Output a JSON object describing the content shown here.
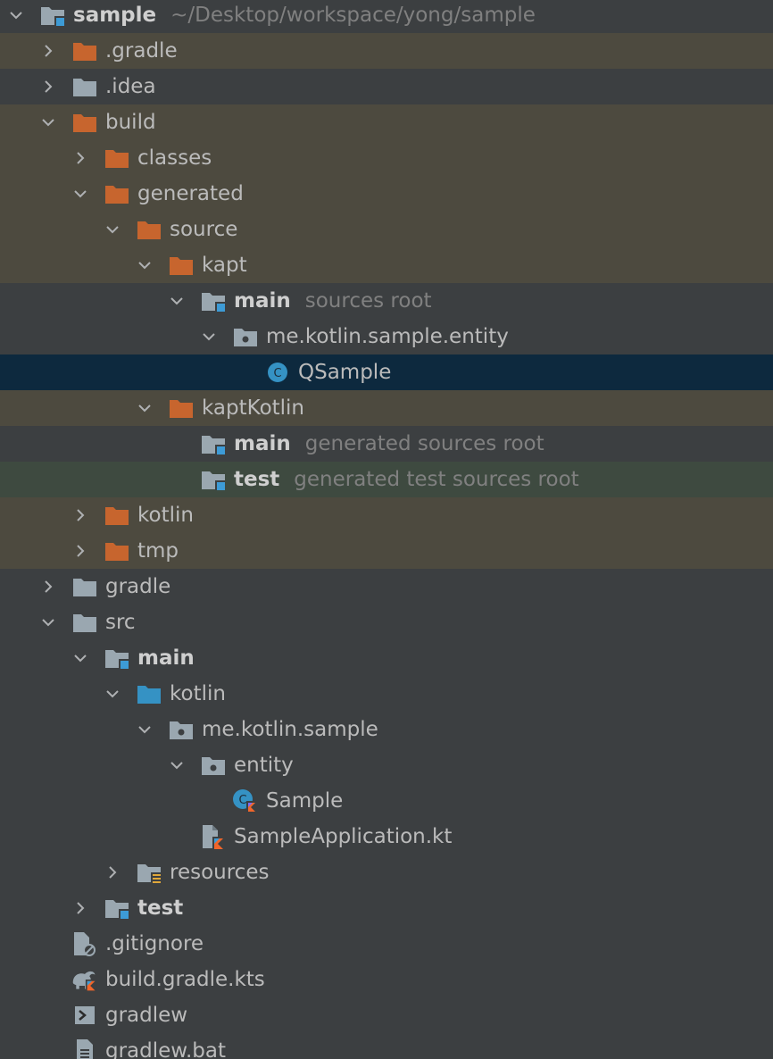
{
  "tree": [
    {
      "name": "sample",
      "hint": "~/Desktop/workspace/yong/sample",
      "bold": true,
      "depth": 0,
      "arrow": "expanded",
      "icon": "module-folder-icon",
      "bg": "none"
    },
    {
      "name": ".gradle",
      "hint": "",
      "bold": false,
      "depth": 1,
      "arrow": "collapsed",
      "icon": "excluded-folder-icon",
      "bg": "excluded"
    },
    {
      "name": ".idea",
      "hint": "",
      "bold": false,
      "depth": 1,
      "arrow": "collapsed",
      "icon": "folder-icon",
      "bg": "generated"
    },
    {
      "name": "build",
      "hint": "",
      "bold": false,
      "depth": 1,
      "arrow": "expanded",
      "icon": "excluded-folder-icon",
      "bg": "excluded"
    },
    {
      "name": "classes",
      "hint": "",
      "bold": false,
      "depth": 2,
      "arrow": "collapsed",
      "icon": "excluded-folder-icon",
      "bg": "excluded"
    },
    {
      "name": "generated",
      "hint": "",
      "bold": false,
      "depth": 2,
      "arrow": "expanded",
      "icon": "excluded-folder-icon",
      "bg": "excluded"
    },
    {
      "name": "source",
      "hint": "",
      "bold": false,
      "depth": 3,
      "arrow": "expanded",
      "icon": "excluded-folder-icon",
      "bg": "excluded"
    },
    {
      "name": "kapt",
      "hint": "",
      "bold": false,
      "depth": 4,
      "arrow": "expanded",
      "icon": "excluded-folder-icon",
      "bg": "excluded"
    },
    {
      "name": "main",
      "hint": "sources root",
      "bold": true,
      "depth": 5,
      "arrow": "expanded",
      "icon": "source-root-folder-icon",
      "bg": "generated"
    },
    {
      "name": "me.kotlin.sample.entity",
      "hint": "",
      "bold": false,
      "depth": 6,
      "arrow": "expanded",
      "icon": "package-icon",
      "bg": "generated"
    },
    {
      "name": "QSample",
      "hint": "",
      "bold": false,
      "depth": 7,
      "arrow": "none",
      "icon": "java-class-icon",
      "bg": "selected"
    },
    {
      "name": "kaptKotlin",
      "hint": "",
      "bold": false,
      "depth": 4,
      "arrow": "expanded",
      "icon": "excluded-folder-icon",
      "bg": "excluded"
    },
    {
      "name": "main",
      "hint": "generated sources root",
      "bold": true,
      "depth": 5,
      "arrow": "none",
      "icon": "source-root-folder-icon",
      "bg": "generated"
    },
    {
      "name": "test",
      "hint": "generated test sources root",
      "bold": true,
      "depth": 5,
      "arrow": "none",
      "icon": "source-root-folder-icon",
      "bg": "hovered"
    },
    {
      "name": "kotlin",
      "hint": "",
      "bold": false,
      "depth": 2,
      "arrow": "collapsed",
      "icon": "excluded-folder-icon",
      "bg": "excluded"
    },
    {
      "name": "tmp",
      "hint": "",
      "bold": false,
      "depth": 2,
      "arrow": "collapsed",
      "icon": "excluded-folder-icon",
      "bg": "excluded"
    },
    {
      "name": "gradle",
      "hint": "",
      "bold": false,
      "depth": 1,
      "arrow": "collapsed",
      "icon": "folder-icon",
      "bg": "none"
    },
    {
      "name": "src",
      "hint": "",
      "bold": false,
      "depth": 1,
      "arrow": "expanded",
      "icon": "folder-icon",
      "bg": "none"
    },
    {
      "name": "main",
      "hint": "",
      "bold": true,
      "depth": 2,
      "arrow": "expanded",
      "icon": "module-folder-icon",
      "bg": "none"
    },
    {
      "name": "kotlin",
      "hint": "",
      "bold": false,
      "depth": 3,
      "arrow": "expanded",
      "icon": "source-folder-icon",
      "bg": "none"
    },
    {
      "name": "me.kotlin.sample",
      "hint": "",
      "bold": false,
      "depth": 4,
      "arrow": "expanded",
      "icon": "package-icon",
      "bg": "none"
    },
    {
      "name": "entity",
      "hint": "",
      "bold": false,
      "depth": 5,
      "arrow": "expanded",
      "icon": "package-icon",
      "bg": "none"
    },
    {
      "name": "Sample",
      "hint": "",
      "bold": false,
      "depth": 6,
      "arrow": "none",
      "icon": "kotlin-class-icon",
      "bg": "none"
    },
    {
      "name": "SampleApplication.kt",
      "hint": "",
      "bold": false,
      "depth": 5,
      "arrow": "none",
      "icon": "kotlin-file-icon",
      "bg": "none"
    },
    {
      "name": "resources",
      "hint": "",
      "bold": false,
      "depth": 3,
      "arrow": "collapsed",
      "icon": "resources-folder-icon",
      "bg": "none"
    },
    {
      "name": "test",
      "hint": "",
      "bold": true,
      "depth": 2,
      "arrow": "collapsed",
      "icon": "module-folder-icon",
      "bg": "none"
    },
    {
      "name": ".gitignore",
      "hint": "",
      "bold": false,
      "depth": 1,
      "arrow": "none",
      "icon": "ignore-file-icon",
      "bg": "none"
    },
    {
      "name": "build.gradle.kts",
      "hint": "",
      "bold": false,
      "depth": 1,
      "arrow": "none",
      "icon": "gradle-kts-file-icon",
      "bg": "none"
    },
    {
      "name": "gradlew",
      "hint": "",
      "bold": false,
      "depth": 1,
      "arrow": "none",
      "icon": "shell-script-icon",
      "bg": "none"
    },
    {
      "name": "gradlew.bat",
      "hint": "",
      "bold": false,
      "depth": 1,
      "arrow": "none",
      "icon": "text-file-icon",
      "bg": "none"
    }
  ],
  "colors": {
    "excluded_folder": "#c7652e",
    "plain_folder": "#9aa7b0",
    "source_folder": "#3592c4",
    "root_badge": "#3d9bd6",
    "excluded_bg": "#4d4a3f",
    "selected_bg": "#0d293e",
    "hover_bg": "#3e4a40",
    "panel_bg": "#3c3f41"
  }
}
